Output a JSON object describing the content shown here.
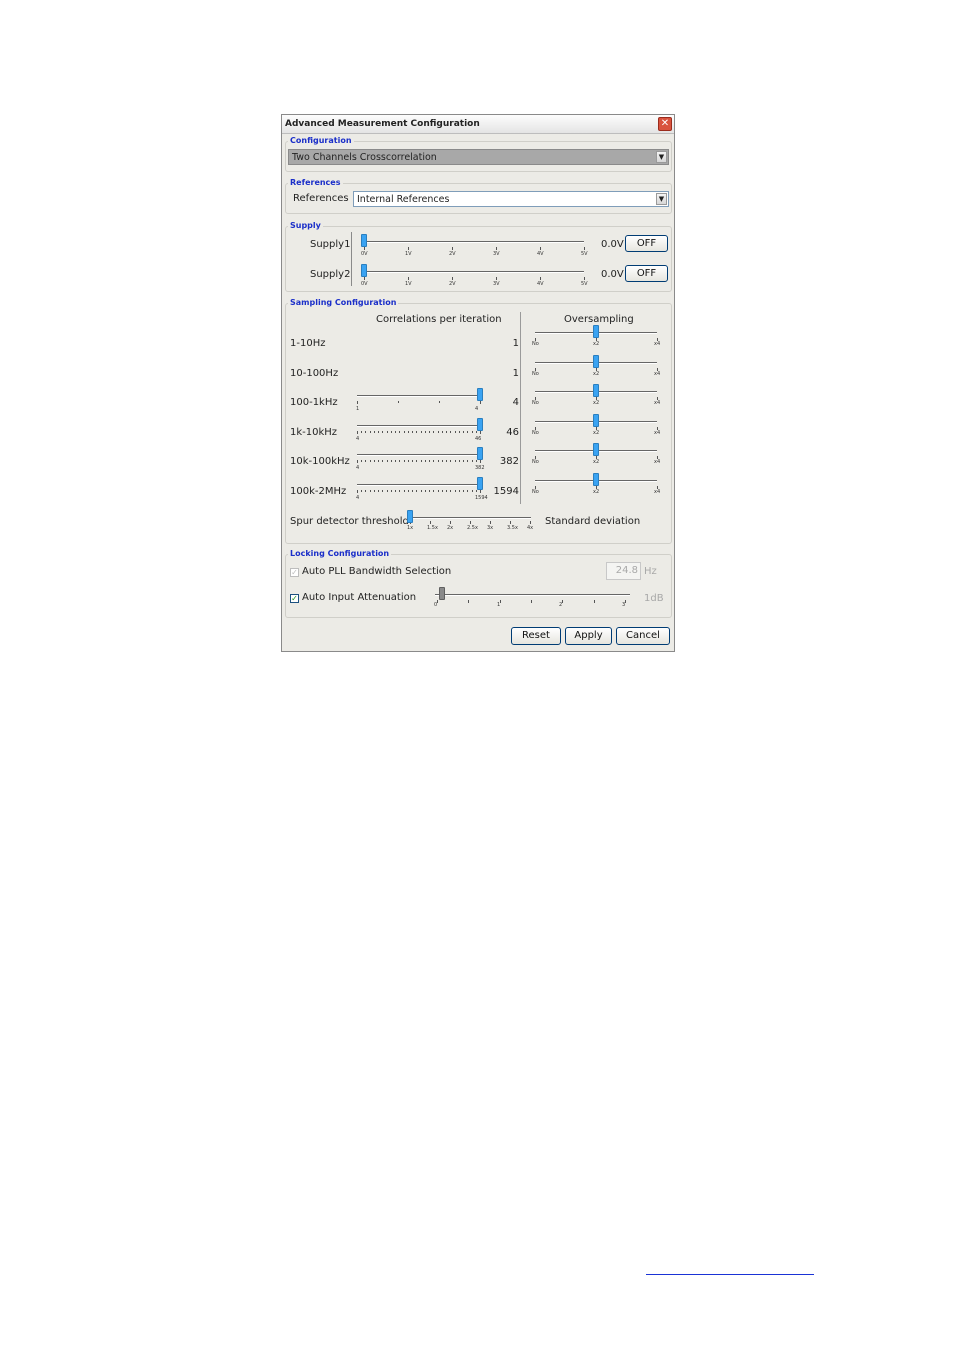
{
  "window": {
    "title": "Advanced Measurement Configuration",
    "close_glyph": "✕"
  },
  "configuration": {
    "title": "Configuration",
    "value": "Two Channels Crosscorrelation"
  },
  "references": {
    "title": "References",
    "label": "References",
    "value": "Internal References"
  },
  "supply": {
    "title": "Supply",
    "scale": [
      "0V",
      "1V",
      "2V",
      "3V",
      "4V",
      "5V"
    ],
    "rows": [
      {
        "label": "Supply1",
        "value": "0.0V",
        "button": "OFF",
        "level": 0
      },
      {
        "label": "Supply2",
        "value": "0.0V",
        "button": "OFF",
        "level": 0
      }
    ]
  },
  "sampling": {
    "title": "Sampling Configuration",
    "corr_header": "Correlations per iteration",
    "over_header": "Oversampling",
    "over_scale": [
      "No",
      "x2",
      "x4"
    ],
    "rows": [
      {
        "label": "1-10Hz",
        "count": "1",
        "has_slider": false,
        "scale_min": "",
        "scale_max": "",
        "level": 1,
        "over_level": 0.5
      },
      {
        "label": "10-100Hz",
        "count": "1",
        "has_slider": false,
        "scale_min": "",
        "scale_max": "",
        "level": 1,
        "over_level": 0.5
      },
      {
        "label": "100-1kHz",
        "count": "4",
        "has_slider": true,
        "scale_min": "1",
        "scale_max": "4",
        "level": 1,
        "over_level": 0.5
      },
      {
        "label": "1k-10kHz",
        "count": "46",
        "has_slider": true,
        "scale_min": "4",
        "scale_max": "46",
        "level": 1,
        "over_level": 0.5
      },
      {
        "label": "10k-100kHz",
        "count": "382",
        "has_slider": true,
        "scale_min": "4",
        "scale_max": "382",
        "level": 1,
        "over_level": 0.5
      },
      {
        "label": "100k-2MHz",
        "count": "1594",
        "has_slider": true,
        "scale_min": "4",
        "scale_max": "1594",
        "level": 1,
        "over_level": 0.5
      }
    ],
    "spur_label": "Spur detector threshold",
    "spur_scale": [
      "1x",
      "1.5x",
      "2x",
      "2.5x",
      "3x",
      "3.5x",
      "4x"
    ],
    "spur_level": 0,
    "spur_unit": "Standard deviation"
  },
  "locking": {
    "title": "Locking Configuration",
    "pll_label": "Auto PLL Bandwidth Selection",
    "pll_checked": true,
    "pll_value": "24.8",
    "pll_unit": "Hz",
    "atten_label": "Auto Input Attenuation",
    "atten_checked": true,
    "atten_scale": [
      "0",
      "1",
      "2",
      "3"
    ],
    "atten_level": 0,
    "atten_value": "1dB",
    "check_glyph": "✓"
  },
  "buttons": {
    "reset": "Reset",
    "apply": "Apply",
    "cancel": "Cancel"
  },
  "colors": {
    "group_title": "#1b2fc9",
    "slider_thumb": "#3aa3f2",
    "link": "#1a33d6"
  }
}
